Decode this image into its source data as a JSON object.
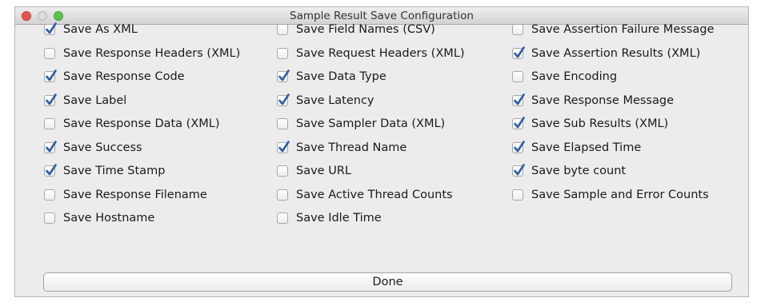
{
  "window": {
    "title": "Sample Result Save Configuration"
  },
  "options": [
    {
      "label": "Save As XML",
      "checked": true
    },
    {
      "label": "Save Response Headers (XML)",
      "checked": false
    },
    {
      "label": "Save Response Code",
      "checked": true
    },
    {
      "label": "Save Label",
      "checked": true
    },
    {
      "label": "Save Response Data (XML)",
      "checked": false
    },
    {
      "label": "Save Success",
      "checked": true
    },
    {
      "label": "Save Time Stamp",
      "checked": true
    },
    {
      "label": "Save Response Filename",
      "checked": false
    },
    {
      "label": "Save Hostname",
      "checked": false
    },
    {
      "label": "Save Field Names (CSV)",
      "checked": false
    },
    {
      "label": "Save Request Headers (XML)",
      "checked": false
    },
    {
      "label": "Save Data Type",
      "checked": true
    },
    {
      "label": "Save Latency",
      "checked": true
    },
    {
      "label": "Save Sampler Data (XML)",
      "checked": false
    },
    {
      "label": "Save Thread Name",
      "checked": true
    },
    {
      "label": "Save URL",
      "checked": false
    },
    {
      "label": "Save Active Thread Counts",
      "checked": false
    },
    {
      "label": "Save Idle Time",
      "checked": false
    },
    {
      "label": "Save Assertion Failure Message",
      "checked": false
    },
    {
      "label": "Save Assertion Results (XML)",
      "checked": true
    },
    {
      "label": "Save Encoding",
      "checked": false
    },
    {
      "label": "Save Response Message",
      "checked": true
    },
    {
      "label": "Save Sub Results (XML)",
      "checked": true
    },
    {
      "label": "Save Elapsed Time",
      "checked": true
    },
    {
      "label": "Save byte count",
      "checked": true
    },
    {
      "label": "Save Sample and Error Counts",
      "checked": false
    }
  ],
  "done_button": {
    "label": "Done"
  },
  "colors": {
    "checkmark": "#2b5fa8",
    "traffic_close": "#e9534e",
    "traffic_min": "#dcdcdc",
    "traffic_max": "#5ec24d"
  }
}
